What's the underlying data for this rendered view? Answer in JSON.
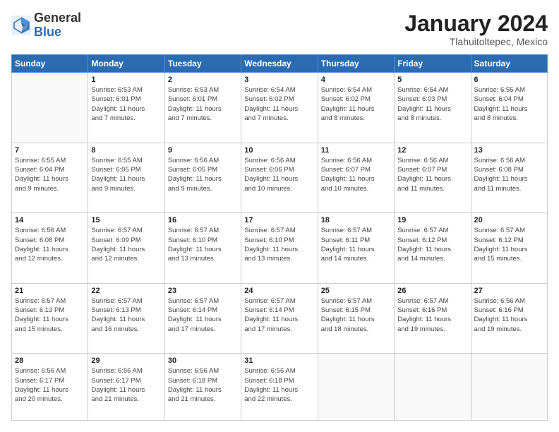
{
  "logo": {
    "general": "General",
    "blue": "Blue"
  },
  "title": {
    "month_year": "January 2024",
    "location": "Tlahuitoltepec, Mexico"
  },
  "weekdays": [
    "Sunday",
    "Monday",
    "Tuesday",
    "Wednesday",
    "Thursday",
    "Friday",
    "Saturday"
  ],
  "weeks": [
    [
      {
        "day": "",
        "info": ""
      },
      {
        "day": "1",
        "info": "Sunrise: 6:53 AM\nSunset: 6:01 PM\nDaylight: 11 hours\nand 7 minutes."
      },
      {
        "day": "2",
        "info": "Sunrise: 6:53 AM\nSunset: 6:01 PM\nDaylight: 11 hours\nand 7 minutes."
      },
      {
        "day": "3",
        "info": "Sunrise: 6:54 AM\nSunset: 6:02 PM\nDaylight: 11 hours\nand 7 minutes."
      },
      {
        "day": "4",
        "info": "Sunrise: 6:54 AM\nSunset: 6:02 PM\nDaylight: 11 hours\nand 8 minutes."
      },
      {
        "day": "5",
        "info": "Sunrise: 6:54 AM\nSunset: 6:03 PM\nDaylight: 11 hours\nand 8 minutes."
      },
      {
        "day": "6",
        "info": "Sunrise: 6:55 AM\nSunset: 6:04 PM\nDaylight: 11 hours\nand 8 minutes."
      }
    ],
    [
      {
        "day": "7",
        "info": "Sunrise: 6:55 AM\nSunset: 6:04 PM\nDaylight: 11 hours\nand 9 minutes."
      },
      {
        "day": "8",
        "info": "Sunrise: 6:55 AM\nSunset: 6:05 PM\nDaylight: 11 hours\nand 9 minutes."
      },
      {
        "day": "9",
        "info": "Sunrise: 6:56 AM\nSunset: 6:05 PM\nDaylight: 11 hours\nand 9 minutes."
      },
      {
        "day": "10",
        "info": "Sunrise: 6:56 AM\nSunset: 6:06 PM\nDaylight: 11 hours\nand 10 minutes."
      },
      {
        "day": "11",
        "info": "Sunrise: 6:56 AM\nSunset: 6:07 PM\nDaylight: 11 hours\nand 10 minutes."
      },
      {
        "day": "12",
        "info": "Sunrise: 6:56 AM\nSunset: 6:07 PM\nDaylight: 11 hours\nand 11 minutes."
      },
      {
        "day": "13",
        "info": "Sunrise: 6:56 AM\nSunset: 6:08 PM\nDaylight: 11 hours\nand 11 minutes."
      }
    ],
    [
      {
        "day": "14",
        "info": "Sunrise: 6:56 AM\nSunset: 6:08 PM\nDaylight: 11 hours\nand 12 minutes."
      },
      {
        "day": "15",
        "info": "Sunrise: 6:57 AM\nSunset: 6:09 PM\nDaylight: 11 hours\nand 12 minutes."
      },
      {
        "day": "16",
        "info": "Sunrise: 6:57 AM\nSunset: 6:10 PM\nDaylight: 11 hours\nand 13 minutes."
      },
      {
        "day": "17",
        "info": "Sunrise: 6:57 AM\nSunset: 6:10 PM\nDaylight: 11 hours\nand 13 minutes."
      },
      {
        "day": "18",
        "info": "Sunrise: 6:57 AM\nSunset: 6:11 PM\nDaylight: 11 hours\nand 14 minutes."
      },
      {
        "day": "19",
        "info": "Sunrise: 6:57 AM\nSunset: 6:12 PM\nDaylight: 11 hours\nand 14 minutes."
      },
      {
        "day": "20",
        "info": "Sunrise: 6:57 AM\nSunset: 6:12 PM\nDaylight: 11 hours\nand 15 minutes."
      }
    ],
    [
      {
        "day": "21",
        "info": "Sunrise: 6:57 AM\nSunset: 6:13 PM\nDaylight: 11 hours\nand 15 minutes."
      },
      {
        "day": "22",
        "info": "Sunrise: 6:57 AM\nSunset: 6:13 PM\nDaylight: 11 hours\nand 16 minutes."
      },
      {
        "day": "23",
        "info": "Sunrise: 6:57 AM\nSunset: 6:14 PM\nDaylight: 11 hours\nand 17 minutes."
      },
      {
        "day": "24",
        "info": "Sunrise: 6:57 AM\nSunset: 6:14 PM\nDaylight: 11 hours\nand 17 minutes."
      },
      {
        "day": "25",
        "info": "Sunrise: 6:57 AM\nSunset: 6:15 PM\nDaylight: 11 hours\nand 18 minutes."
      },
      {
        "day": "26",
        "info": "Sunrise: 6:57 AM\nSunset: 6:16 PM\nDaylight: 11 hours\nand 19 minutes."
      },
      {
        "day": "27",
        "info": "Sunrise: 6:56 AM\nSunset: 6:16 PM\nDaylight: 11 hours\nand 19 minutes."
      }
    ],
    [
      {
        "day": "28",
        "info": "Sunrise: 6:56 AM\nSunset: 6:17 PM\nDaylight: 11 hours\nand 20 minutes."
      },
      {
        "day": "29",
        "info": "Sunrise: 6:56 AM\nSunset: 6:17 PM\nDaylight: 11 hours\nand 21 minutes."
      },
      {
        "day": "30",
        "info": "Sunrise: 6:56 AM\nSunset: 6:18 PM\nDaylight: 11 hours\nand 21 minutes."
      },
      {
        "day": "31",
        "info": "Sunrise: 6:56 AM\nSunset: 6:18 PM\nDaylight: 11 hours\nand 22 minutes."
      },
      {
        "day": "",
        "info": ""
      },
      {
        "day": "",
        "info": ""
      },
      {
        "day": "",
        "info": ""
      }
    ]
  ]
}
